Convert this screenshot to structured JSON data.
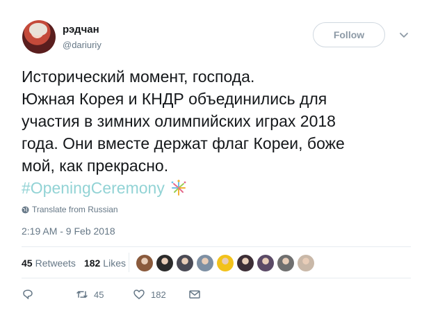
{
  "author": {
    "display_name": "рэдчан",
    "handle": "@dariuriy",
    "avatar_icon": "profile-photo"
  },
  "follow_label": "Follow",
  "tweet": {
    "lines": [
      "Исторический момент, господа.",
      "Южная Корея и КНДР объединились для",
      "участия в зимних олимпийских играх 2018",
      "года. Они вместе держат флаг Кореи, боже",
      "мой, как прекрасно."
    ],
    "hashtag": "#OpeningCeremony",
    "hashtag_icon": "fireworks-icon"
  },
  "translate_label": "Translate from Russian",
  "timestamp": "2:19 AM - 9 Feb 2018",
  "stats": {
    "retweets_count": "45",
    "retweets_label": "Retweets",
    "likes_count": "182",
    "likes_label": "Likes"
  },
  "likers": [
    {
      "name": "liker-avatar-1",
      "color": "#8a5a3c"
    },
    {
      "name": "liker-avatar-2",
      "color": "#2b2b2b"
    },
    {
      "name": "liker-avatar-3",
      "color": "#4a4a55"
    },
    {
      "name": "liker-avatar-4",
      "color": "#7d8fa3"
    },
    {
      "name": "liker-avatar-5",
      "color": "#f2c21b"
    },
    {
      "name": "liker-avatar-6",
      "color": "#3c2e36"
    },
    {
      "name": "liker-avatar-7",
      "color": "#5b4a66"
    },
    {
      "name": "liker-avatar-8",
      "color": "#6f6f6f"
    },
    {
      "name": "liker-avatar-9",
      "color": "#c9b8a8"
    }
  ],
  "actions": {
    "reply_icon": "reply-icon",
    "retweet_icon": "retweet-icon",
    "retweet_count": "45",
    "like_icon": "heart-icon",
    "like_count": "182",
    "dm_icon": "direct-message-icon"
  },
  "colors": {
    "hashtag": "#92d3d5",
    "muted": "#657786",
    "divider": "#e6ecf0"
  }
}
